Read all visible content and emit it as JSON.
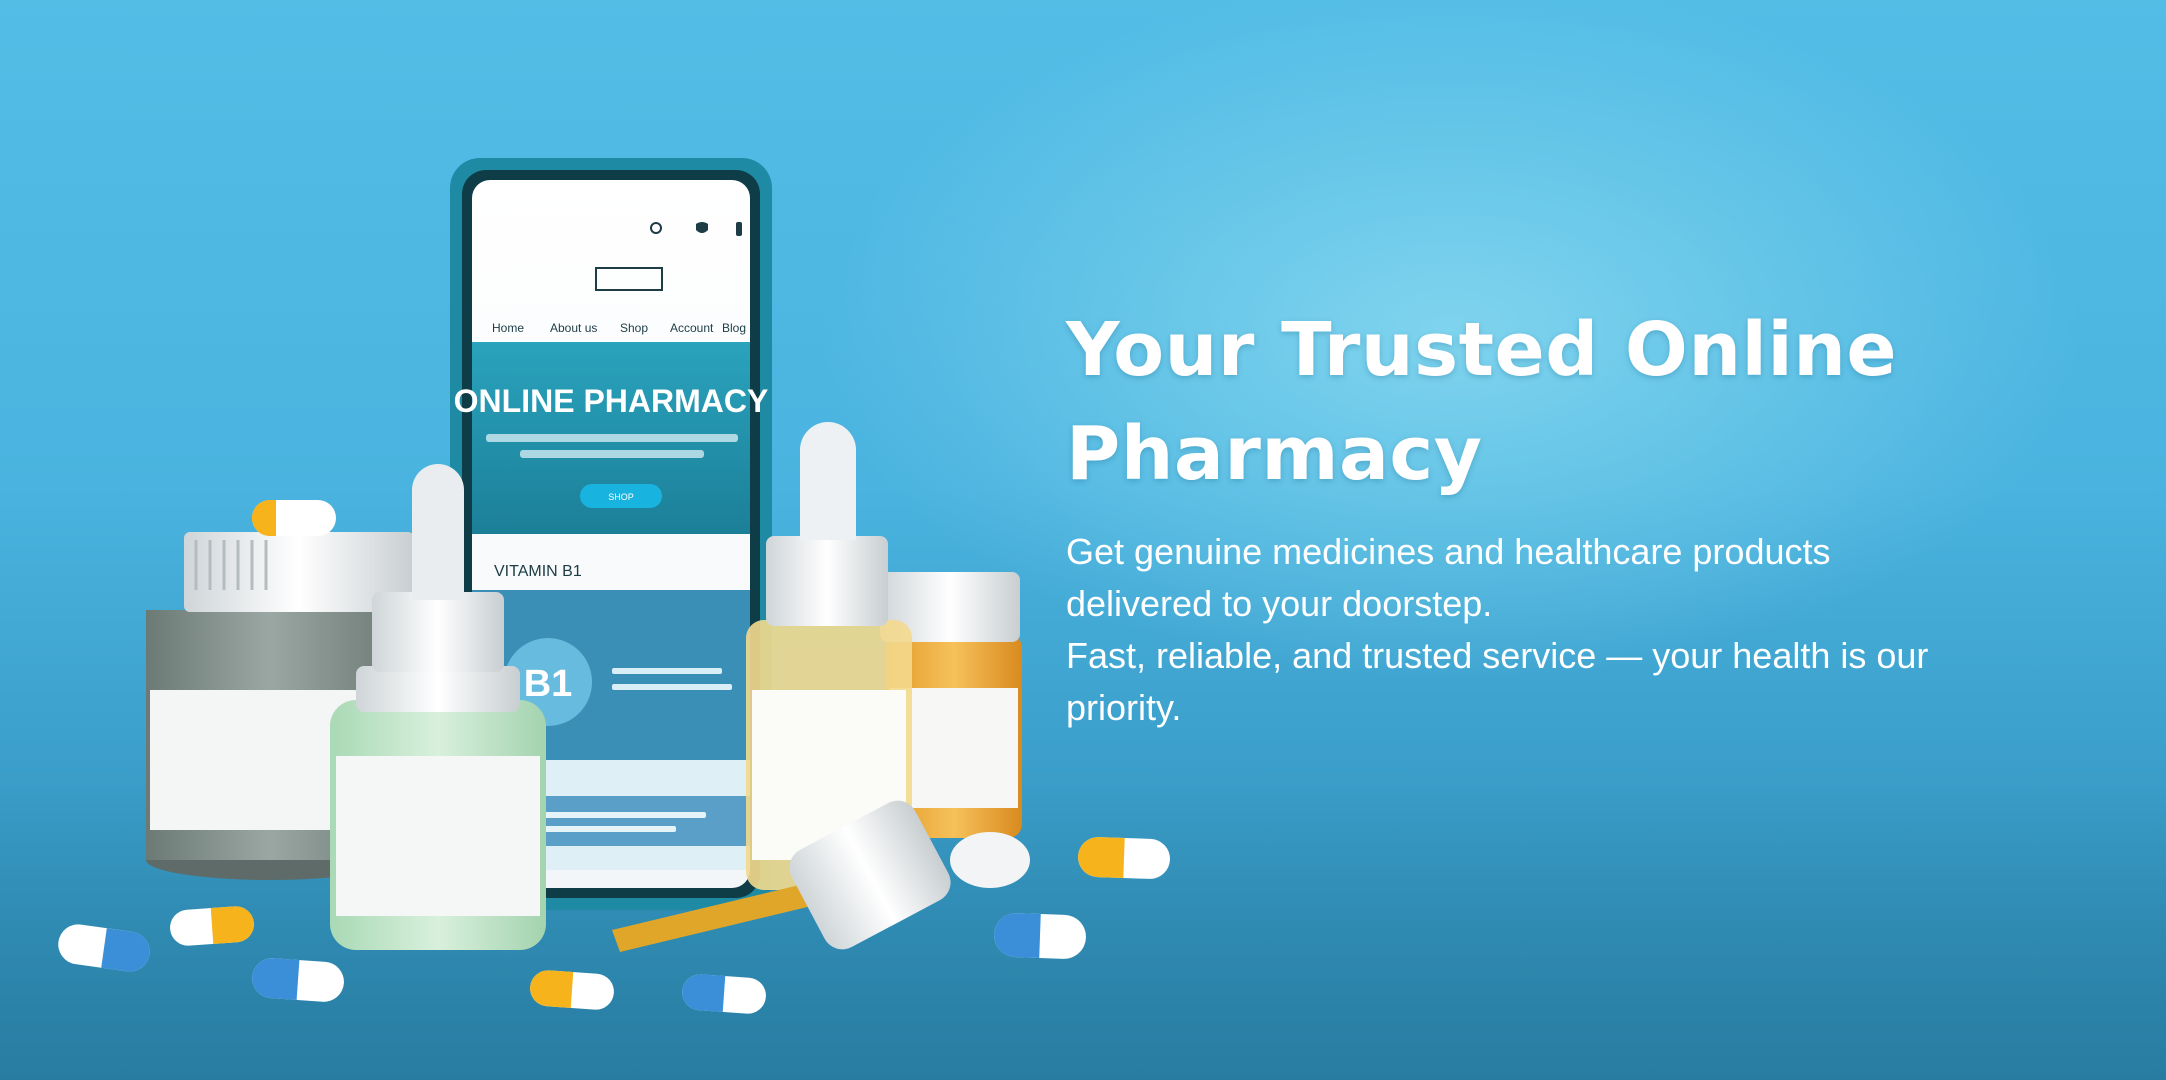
{
  "hero": {
    "title": "Your Trusted Online Pharmacy",
    "description_line1": "Get genuine medicines and healthcare products delivered to your doorstep.",
    "description_line2": "Fast, reliable, and trusted service — your health is our priority."
  },
  "illustration": {
    "phone_nav": [
      "Home",
      "About us",
      "Shop",
      "Account",
      "Blog"
    ],
    "phone_banner_title": "ONLINE PHARMACY",
    "phone_button": "SHOP",
    "phone_section": "VITAMIN B1",
    "vitamin_badge": "B1"
  },
  "colors": {
    "background": "#4ab3df",
    "phone_teal": "#1f8aa3",
    "capsule_yellow": "#f6b31c",
    "capsule_blue": "#3a8fd8"
  }
}
